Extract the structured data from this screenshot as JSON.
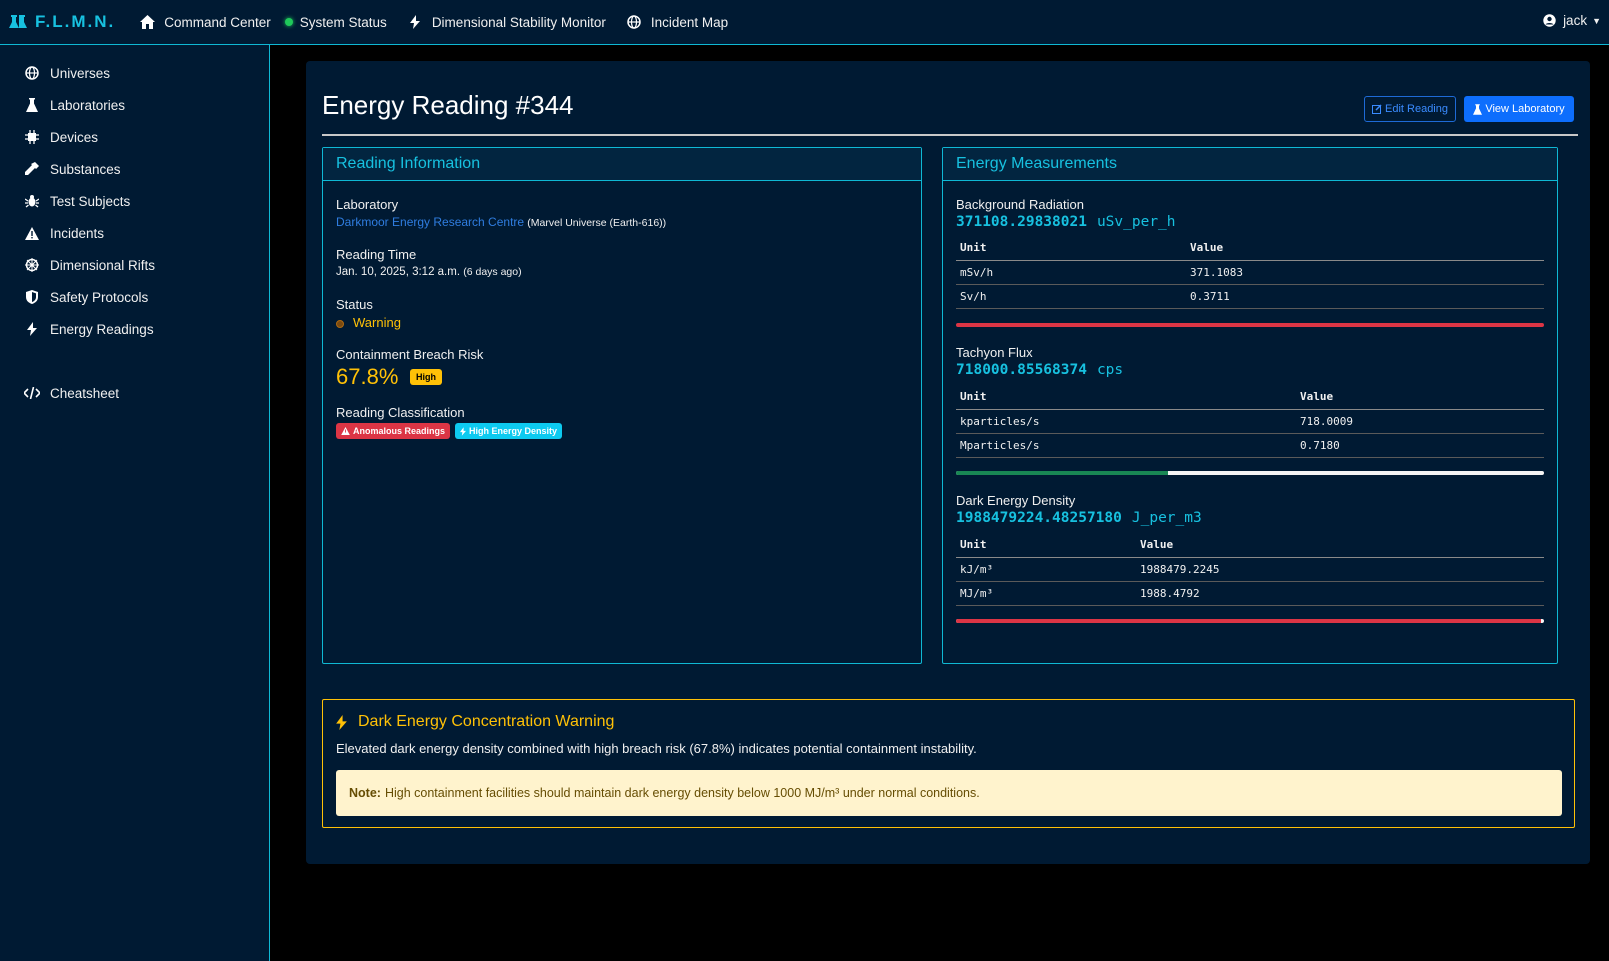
{
  "topnav": {
    "brand": "F.L.M.N.",
    "links": [
      "Command Center",
      "System Status",
      "Dimensional Stability Monitor",
      "Incident Map"
    ],
    "user": "jack"
  },
  "sidebar": {
    "items": [
      "Universes",
      "Laboratories",
      "Devices",
      "Substances",
      "Test Subjects",
      "Incidents",
      "Dimensional Rifts",
      "Safety Protocols",
      "Energy Readings"
    ],
    "cheatsheet": "Cheatsheet"
  },
  "page": {
    "title": "Energy Reading #344",
    "edit_button": "Edit Reading",
    "view_button": "View Laboratory"
  },
  "reading_info": {
    "header": "Reading Information",
    "laboratory_label": "Laboratory",
    "laboratory_name": "Darkmoor Energy Research Centre",
    "laboratory_universe": "(Marvel Universe (Earth-616))",
    "time_label": "Reading Time",
    "time_value": "Jan. 10, 2025, 3:12 a.m.",
    "time_ago": "(6 days ago)",
    "status_label": "Status",
    "status_value": "Warning",
    "risk_label": "Containment Breach Risk",
    "risk_value": "67.8%",
    "risk_badge": "High",
    "classification_label": "Reading Classification",
    "tags": [
      "Anomalous Readings",
      "High Energy Density"
    ]
  },
  "energy": {
    "header": "Energy Measurements",
    "col_unit": "Unit",
    "col_value": "Value",
    "measurements": [
      {
        "label": "Background Radiation",
        "value": "371108.29838021",
        "unit": "uSv_per_h",
        "rows": [
          [
            "mSv/h",
            "371.1083"
          ],
          [
            "Sv/h",
            "0.3711"
          ]
        ],
        "bar_fraction": 1.0,
        "bar_color": "#dc3545"
      },
      {
        "label": "Tachyon Flux",
        "value": "718000.85568374",
        "unit": "cps",
        "rows": [
          [
            "kparticles/s",
            "718.0009"
          ],
          [
            "Mparticles/s",
            "0.7180"
          ]
        ],
        "bar_fraction": 0.36,
        "bar_color": "#198754"
      },
      {
        "label": "Dark Energy Density",
        "value": "1988479224.48257180",
        "unit": "J_per_m3",
        "rows": [
          [
            "kJ/m³",
            "1988479.2245"
          ],
          [
            "MJ/m³",
            "1988.4792"
          ]
        ],
        "bar_fraction": 0.995,
        "bar_color": "#dc3545"
      }
    ]
  },
  "warning": {
    "title": "Dark Energy Concentration Warning",
    "text": "Elevated dark energy density combined with high breach risk (67.8%) indicates potential containment instability.",
    "note_label": "Note:",
    "note_text": "High containment facilities should maintain dark energy density below 1000 MJ/m³ under normal conditions."
  }
}
